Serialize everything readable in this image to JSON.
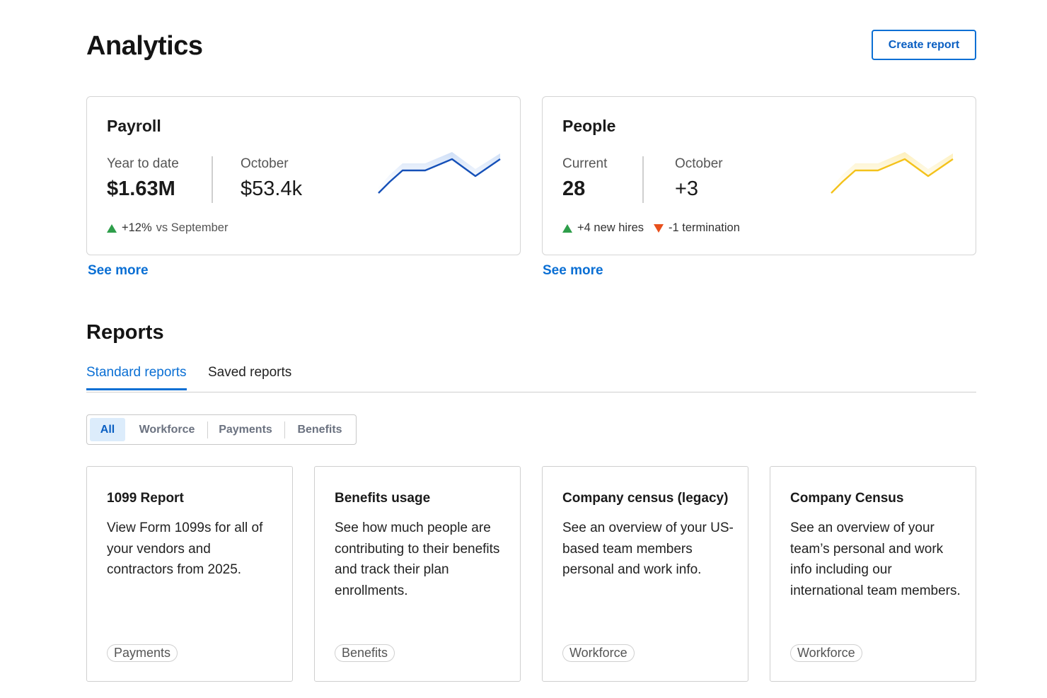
{
  "header": {
    "title": "Analytics",
    "create_button": "Create report"
  },
  "colors": {
    "accent": "#0a6fd4",
    "payroll_line": "#1550b8",
    "people_line": "#f4c21b",
    "up": "#2e9e4a",
    "down": "#e8501c"
  },
  "payroll": {
    "title": "Payroll",
    "metric1_label": "Year to date",
    "metric1_value": "$1.63M",
    "metric2_label": "October",
    "metric2_value": "$53.4k",
    "trend_value": "+12%",
    "trend_suffix": "vs  September",
    "see_more": "See more"
  },
  "people": {
    "title": "People",
    "metric1_label": "Current",
    "metric1_value": "28",
    "metric2_label": "October",
    "metric2_value": "+3",
    "trend_up": "+4 new hires",
    "trend_down": "-1 termination",
    "see_more": "See more"
  },
  "reports": {
    "title": "Reports",
    "tabs": [
      {
        "label": "Standard reports",
        "active": true
      },
      {
        "label": "Saved reports",
        "active": false
      }
    ],
    "filters": [
      {
        "label": "All",
        "active": true
      },
      {
        "label": "Workforce",
        "active": false
      },
      {
        "label": "Payments",
        "active": false
      },
      {
        "label": "Benefits",
        "active": false
      }
    ],
    "cards": [
      {
        "title": "1099 Report",
        "description": "View Form 1099s for all of your vendors and contractors from 2025.",
        "tag": "Payments"
      },
      {
        "title": "Benefits usage",
        "description": "See how much people are contributing to their benefits and track their plan enrollments.",
        "tag": "Benefits"
      },
      {
        "title": "Company census (legacy)",
        "description": "See an overview of your US-based team members personal and work info.",
        "tag": "Workforce"
      },
      {
        "title": "Company Census",
        "description": "See an overview of your team’s personal and work info including our international team members.",
        "tag": "Workforce"
      }
    ]
  }
}
